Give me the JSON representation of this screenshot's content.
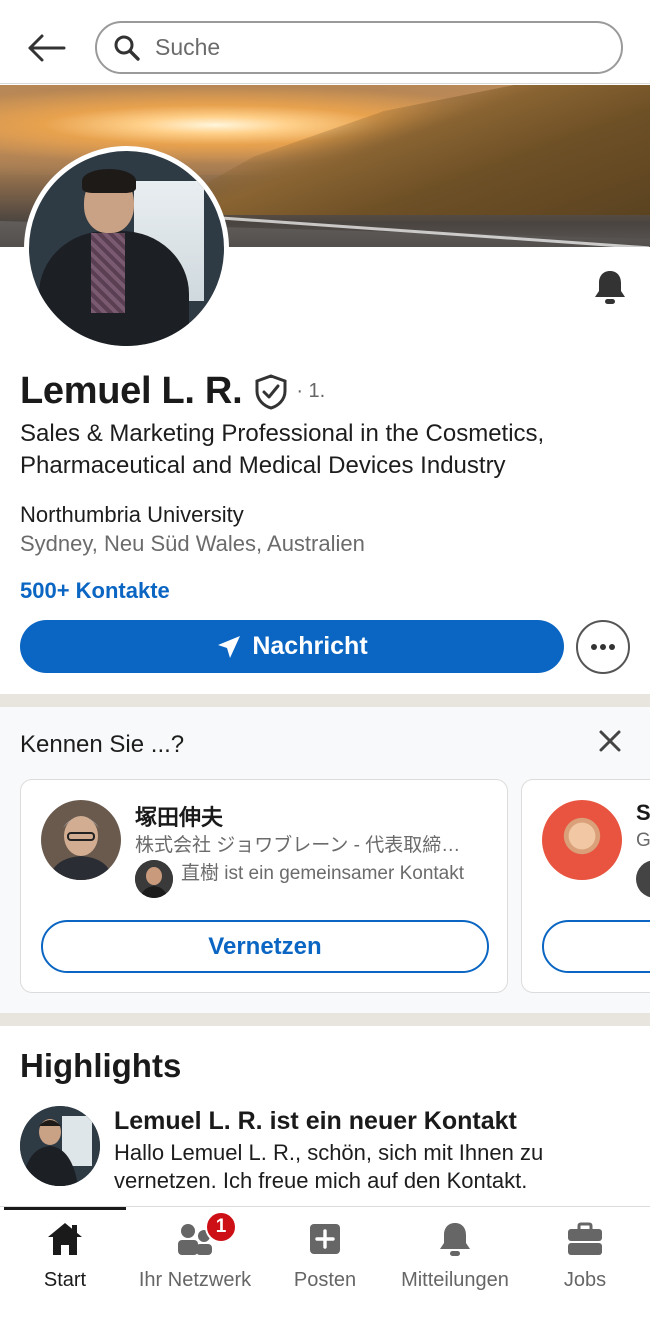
{
  "search": {
    "placeholder": "Suche"
  },
  "profile": {
    "name": "Lemuel L. R.",
    "degree": "· 1.",
    "headline": "Sales & Marketing Professional in the Cosmetics, Pharmaceutical and Medical Devices Industry",
    "education": "Northumbria University",
    "location": "Sydney, Neu Süd Wales, Australien",
    "contacts": "500+ Kontakte",
    "message_label": "Nachricht"
  },
  "pymk": {
    "title": "Kennen Sie ...?",
    "cards": [
      {
        "name": "塚田伸夫",
        "title": "株式会社 ジョワブレーン - 代表取締…",
        "mutual": "直樹 ist ein gemeinsamer Kontakt",
        "button": "Vernetzen"
      },
      {
        "name": "S",
        "title": "G"
      }
    ]
  },
  "highlights": {
    "title": "Highlights",
    "heading": "Lemuel L. R. ist ein neuer Kontakt",
    "text": "Hallo Lemuel L. R., schön, sich mit Ihnen zu vernetzen. Ich freue mich auf den Kontakt."
  },
  "nav": {
    "items": [
      {
        "label": "Start",
        "icon": "home-icon"
      },
      {
        "label": "Ihr Netzwerk",
        "icon": "network-icon"
      },
      {
        "label": "Posten",
        "icon": "post-icon"
      },
      {
        "label": "Mitteilungen",
        "icon": "notifications-icon"
      },
      {
        "label": "Jobs",
        "icon": "jobs-icon"
      }
    ],
    "network_badge": "1"
  },
  "colors": {
    "accent": "#0a66c2",
    "badge": "#cc1016"
  }
}
